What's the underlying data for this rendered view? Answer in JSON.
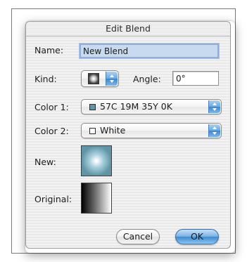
{
  "dialog": {
    "title": "Edit Blend",
    "name_label": "Name:",
    "name_value": "New Blend",
    "kind_label": "Kind:",
    "angle_label": "Angle:",
    "angle_value": "0°",
    "color1_label": "Color 1:",
    "color1_value": "57C 19M 35Y 0K",
    "color1_hex": "#5f95a6",
    "color2_label": "Color 2:",
    "color2_value": "White",
    "color2_hex": "#ffffff",
    "new_label": "New:",
    "original_label": "Original:",
    "cancel_label": "Cancel",
    "ok_label": "OK"
  },
  "icons": {
    "kind_popup": "blend-kind-icon",
    "popup_arrows": "up-down-arrows-icon"
  }
}
